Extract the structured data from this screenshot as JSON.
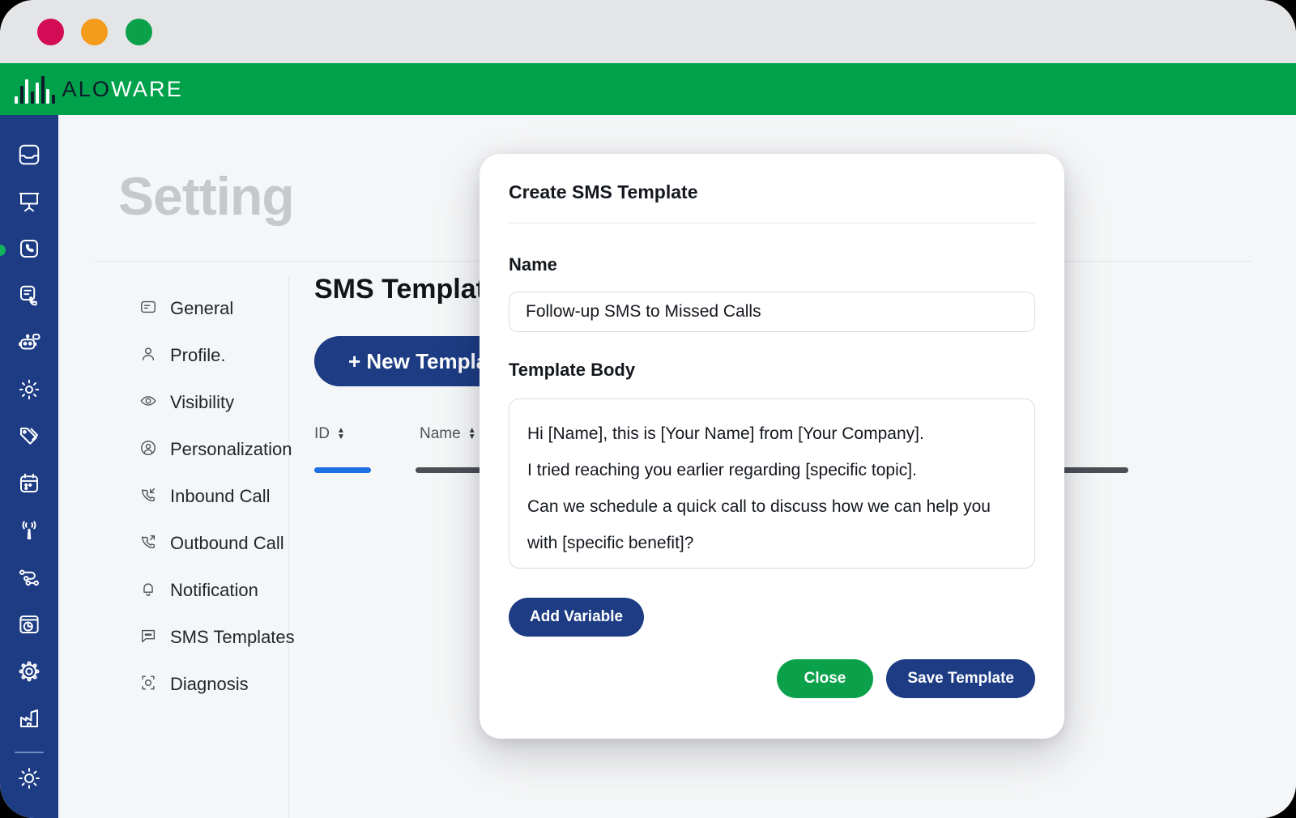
{
  "window": {
    "traffic_lights": [
      {
        "name": "close",
        "color": "#d40b55"
      },
      {
        "name": "minimize",
        "color": "#f59b1c"
      },
      {
        "name": "maximize",
        "color": "#0ba14b"
      }
    ]
  },
  "brand": {
    "name_dark": "ALO",
    "name_light": "WARE",
    "bar_color": "#00a14b"
  },
  "rail": {
    "items": [
      {
        "icon": "inbox-icon",
        "active": false
      },
      {
        "icon": "presentation-icon",
        "active": false
      },
      {
        "icon": "phone-square-icon",
        "active": true
      },
      {
        "icon": "call-log-icon",
        "active": false
      },
      {
        "icon": "chat-bot-icon",
        "active": false
      },
      {
        "icon": "gear-icon",
        "active": false
      },
      {
        "icon": "tag-icon",
        "active": false
      },
      {
        "icon": "calendar-icon",
        "active": false
      },
      {
        "icon": "broadcast-icon",
        "active": false
      },
      {
        "icon": "workflow-icon",
        "active": false
      },
      {
        "icon": "analytics-icon",
        "active": false
      },
      {
        "icon": "integrations-icon",
        "active": false
      },
      {
        "icon": "factory-icon",
        "active": false
      }
    ],
    "theme_toggle_icon": "sun-icon"
  },
  "page": {
    "title": "Setting"
  },
  "settings_nav": {
    "items": [
      {
        "label": "General",
        "icon": "document-icon"
      },
      {
        "label": "Profile.",
        "icon": "user-icon"
      },
      {
        "label": "Visibility",
        "icon": "eye-icon"
      },
      {
        "label": "Personalization",
        "icon": "user-circle-icon"
      },
      {
        "label": "Inbound Call",
        "icon": "phone-in-icon"
      },
      {
        "label": "Outbound Call",
        "icon": "phone-out-icon"
      },
      {
        "label": "Notification",
        "icon": "bell-icon"
      },
      {
        "label": "SMS Templates",
        "icon": "message-icon"
      },
      {
        "label": "Diagnosis",
        "icon": "diagnosis-icon"
      }
    ]
  },
  "panel": {
    "title": "SMS Templates",
    "new_template_label": "+ New Template",
    "table": {
      "columns": [
        {
          "label": "ID",
          "sortable": true
        },
        {
          "label": "Name",
          "sortable": true
        }
      ]
    }
  },
  "modal": {
    "title": "Create SMS Template",
    "name_label": "Name",
    "name_value": "Follow-up SMS to Missed Calls",
    "body_label": "Template Body",
    "body_lines": [
      "Hi [Name], this is [Your Name] from [Your Company].",
      "I tried reaching you earlier regarding [specific topic].",
      "Can we schedule a quick call to discuss how we can help you with [specific benefit]?"
    ],
    "add_variable_label": "Add Variable",
    "close_label": "Close",
    "save_label": "Save Template",
    "accent_navy": "#1d3c84",
    "accent_green": "#0ba14b"
  }
}
